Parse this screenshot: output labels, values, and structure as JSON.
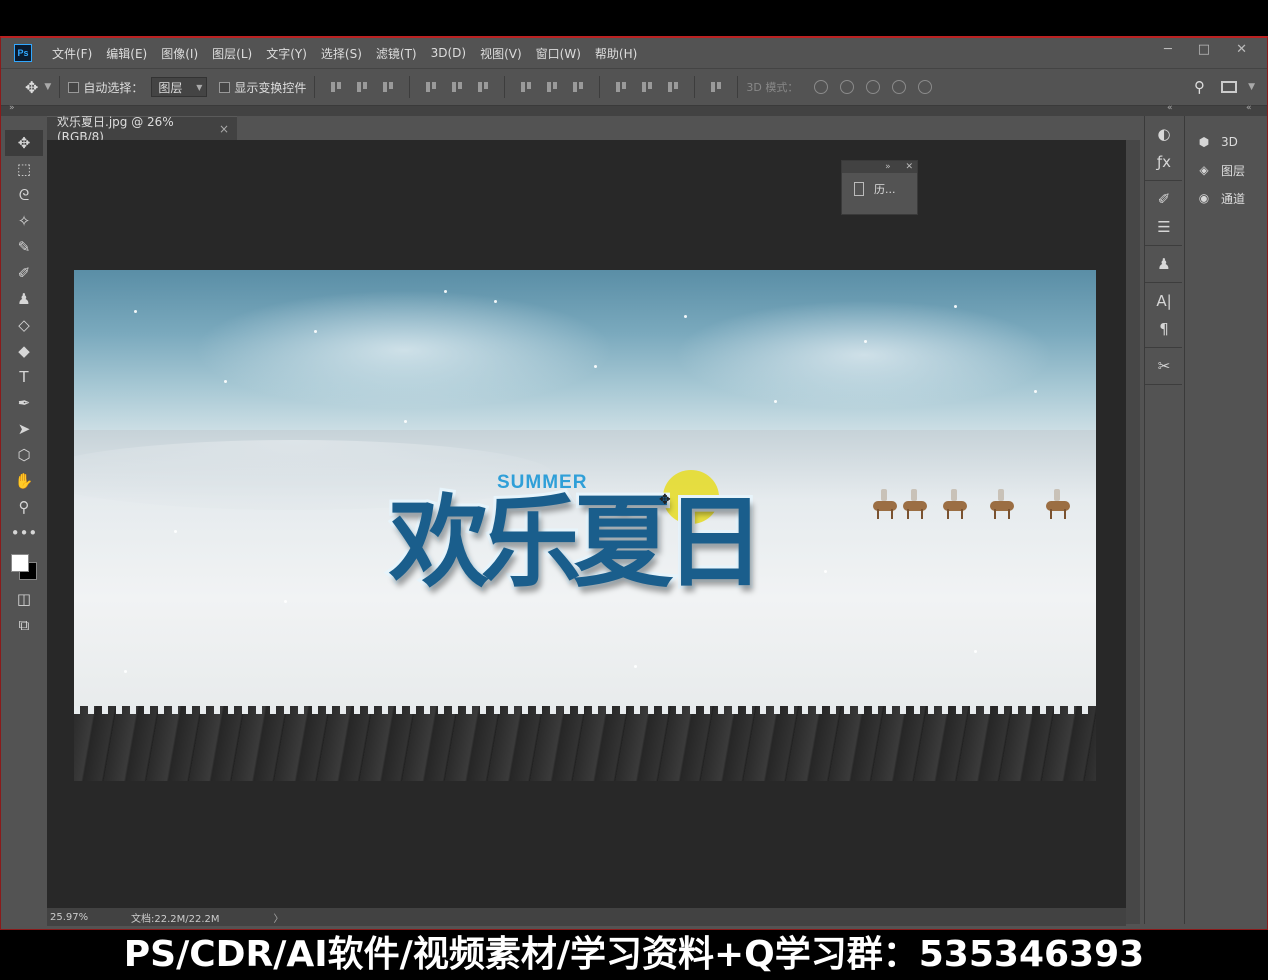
{
  "app": {
    "logo": "Ps"
  },
  "menu": [
    "文件(F)",
    "编辑(E)",
    "图像(I)",
    "图层(L)",
    "文字(Y)",
    "选择(S)",
    "滤镜(T)",
    "3D(D)",
    "视图(V)",
    "窗口(W)",
    "帮助(H)"
  ],
  "window_controls": {
    "minimize": "─",
    "maximize": "□",
    "close": "✕"
  },
  "options": {
    "auto_select_label": "自动选择：",
    "auto_select_value": "图层",
    "show_transform_label": "显示变换控件",
    "mode_3d_label": "3D 模式："
  },
  "document": {
    "tab_title": "欢乐夏日.jpg @ 26%(RGB/8)",
    "tab_close": "×",
    "artwork_small_text": "SUMMER",
    "artwork_title": "欢乐夏日"
  },
  "history_panel": {
    "collapse": "»",
    "close": "✕",
    "label": "历..."
  },
  "status": {
    "zoom": "25.97%",
    "doc_size": "文档:22.2M/22.2M",
    "arrow": "〉"
  },
  "dock": [
    {
      "icon": "cube-icon",
      "glyph": "⬢",
      "label": "3D"
    },
    {
      "icon": "layers-icon",
      "glyph": "◈",
      "label": "图层"
    },
    {
      "icon": "channels-icon",
      "glyph": "◉",
      "label": "通道"
    }
  ],
  "caption": "PS/CDR/AI软件/视频素材/学习资料+Q学习群：535346393",
  "colors": {
    "accent": "#31a8ff",
    "workspace": "#282828",
    "panel": "#535353"
  }
}
